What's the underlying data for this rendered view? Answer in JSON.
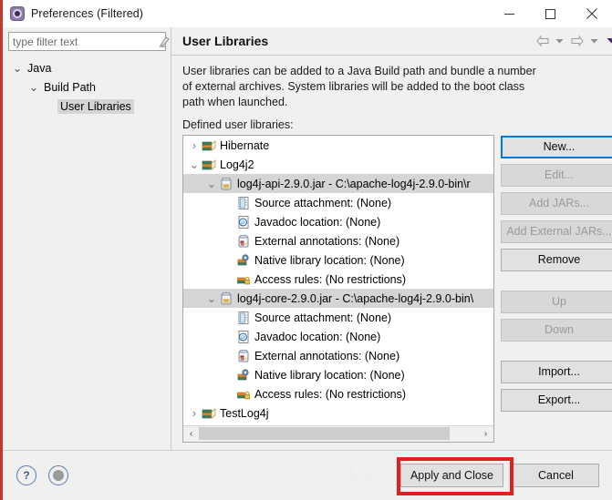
{
  "window": {
    "title": "Preferences (Filtered)",
    "icon": "preferences-gear-icon",
    "minimize_label": "—",
    "maximize_label": "□",
    "close_label": "✕"
  },
  "filter": {
    "placeholder": "type filter text",
    "value": "",
    "clear_icon": "eraser-icon"
  },
  "sidebar": {
    "items": [
      {
        "label": "Java",
        "indent": 0,
        "twist": "⌄",
        "expanded": true,
        "selected": false
      },
      {
        "label": "Build Path",
        "indent": 1,
        "twist": "⌄",
        "expanded": true,
        "selected": false
      },
      {
        "label": "User Libraries",
        "indent": 2,
        "twist": "",
        "expanded": false,
        "selected": true
      }
    ]
  },
  "page": {
    "title": "User Libraries",
    "description": "User libraries can be added to a Java Build path and bundle a number of external archives. System libraries will be added to the boot class path when launched.",
    "defined_label": "Defined user libraries:",
    "nav": [
      {
        "name": "back-arrow-icon",
        "label": "⇦"
      },
      {
        "name": "back-dropdown-icon",
        "label": "▾"
      },
      {
        "name": "forward-arrow-icon",
        "label": "⇨"
      },
      {
        "name": "forward-dropdown-icon",
        "label": "▾"
      },
      {
        "name": "view-menu-dropdown-icon",
        "label": "▾"
      }
    ]
  },
  "tree": {
    "rows": [
      {
        "indent": 0,
        "twist": "›",
        "icon": "library-books-icon",
        "label": "Hibernate",
        "selected": false
      },
      {
        "indent": 0,
        "twist": "⌄",
        "icon": "library-books-icon",
        "label": "Log4j2",
        "selected": false
      },
      {
        "indent": 1,
        "twist": "⌄",
        "icon": "jar-icon",
        "label": "log4j-api-2.9.0.jar - C:\\apache-log4j-2.9.0-bin\\r",
        "selected": true
      },
      {
        "indent": 2,
        "twist": "",
        "icon": "source-attachment-icon",
        "label": "Source attachment: (None)",
        "selected": false
      },
      {
        "indent": 2,
        "twist": "",
        "icon": "javadoc-icon",
        "label": "Javadoc location: (None)",
        "selected": false
      },
      {
        "indent": 2,
        "twist": "",
        "icon": "external-annotations-icon",
        "label": "External annotations: (None)",
        "selected": false
      },
      {
        "indent": 2,
        "twist": "",
        "icon": "native-library-icon",
        "label": "Native library location: (None)",
        "selected": false
      },
      {
        "indent": 2,
        "twist": "",
        "icon": "access-rules-icon",
        "label": "Access rules: (No restrictions)",
        "selected": false
      },
      {
        "indent": 1,
        "twist": "⌄",
        "icon": "jar-icon",
        "label": "log4j-core-2.9.0.jar - C:\\apache-log4j-2.9.0-bin\\",
        "selected": true
      },
      {
        "indent": 2,
        "twist": "",
        "icon": "source-attachment-icon",
        "label": "Source attachment: (None)",
        "selected": false
      },
      {
        "indent": 2,
        "twist": "",
        "icon": "javadoc-icon",
        "label": "Javadoc location: (None)",
        "selected": false
      },
      {
        "indent": 2,
        "twist": "",
        "icon": "external-annotations-icon",
        "label": "External annotations: (None)",
        "selected": false
      },
      {
        "indent": 2,
        "twist": "",
        "icon": "native-library-icon",
        "label": "Native library location: (None)",
        "selected": false
      },
      {
        "indent": 2,
        "twist": "",
        "icon": "access-rules-icon",
        "label": "Access rules: (No restrictions)",
        "selected": false
      },
      {
        "indent": 0,
        "twist": "›",
        "icon": "library-books-icon",
        "label": "TestLog4j",
        "selected": false
      }
    ],
    "hscroll": {
      "left_arrow": "‹",
      "right_arrow": "›"
    }
  },
  "buttons": [
    {
      "label": "New...",
      "state": "focused"
    },
    {
      "label": "Edit...",
      "state": "disabled"
    },
    {
      "label": "Add JARs...",
      "state": "disabled"
    },
    {
      "label": "Add External JARs...",
      "state": "disabled"
    },
    {
      "label": "Remove",
      "state": "enabled"
    },
    {
      "label": "Up",
      "state": "disabled"
    },
    {
      "label": "Down",
      "state": "disabled"
    },
    {
      "label": "Import...",
      "state": "enabled"
    },
    {
      "label": "Export...",
      "state": "enabled"
    }
  ],
  "footer": {
    "help_label": "?",
    "watermark": "http://blog.csdn.net/bakbeom",
    "apply_label": "Apply and Close",
    "cancel_label": "Cancel",
    "highlight_color": "#e02020"
  }
}
